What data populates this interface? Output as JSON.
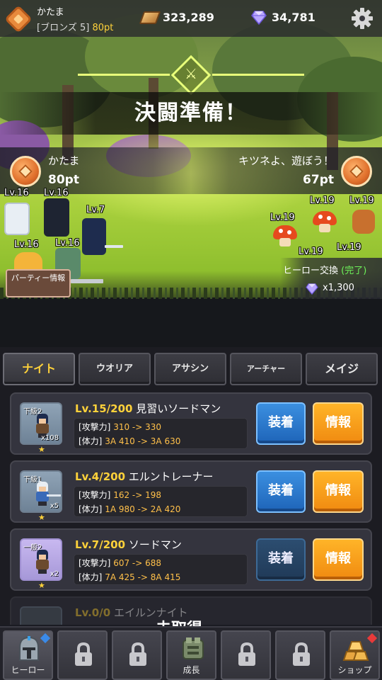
{
  "player": {
    "name": "かたま",
    "rank": "[ブロンズ 5]",
    "points": "80pt"
  },
  "currency": {
    "gold": "323,289",
    "gems": "34,781"
  },
  "duel": {
    "title": "決闘準備！",
    "left": {
      "name": "かたま",
      "points": "80pt"
    },
    "right": {
      "name": "キツネよ、遊ぼう！",
      "points": "67pt"
    }
  },
  "ally_levels": [
    "Lv.16",
    "Lv.16",
    "Lv.7",
    "Lv.16",
    "Lv.16"
  ],
  "enemy_levels": [
    "Lv.19",
    "Lv.19",
    "Lv.19",
    "Lv.19",
    "Lv.19",
    "Lv.19"
  ],
  "party_button": "パーティー情報",
  "exchange": {
    "label": "ヒーロー交換",
    "status": "(完了)",
    "amount": "x1,300"
  },
  "tabs": [
    "ナイト",
    "ウオリア",
    "アサシン",
    "アーチャー",
    "メイジ"
  ],
  "heroes": [
    {
      "grade": "下級2",
      "count": "x108",
      "level": "Lv.15/200",
      "name": "見習いソードマン",
      "atk_label": "[攻撃力]",
      "atk": "310 -> 330",
      "hp_label": "[体力]",
      "hp": "3A 410 -> 3A 630",
      "equip": "装着",
      "info": "情報"
    },
    {
      "grade": "下級1",
      "count": "x5",
      "level": "Lv.4/200",
      "name": "エルントレーナー",
      "atk_label": "[攻撃力]",
      "atk": "162 -> 198",
      "hp_label": "[体力]",
      "hp": "1A 980 -> 2A 420",
      "equip": "装着",
      "info": "情報"
    },
    {
      "grade": "一般2",
      "count": "x2",
      "level": "Lv.7/200",
      "name": "ソードマン",
      "atk_label": "[攻撃力]",
      "atk": "607 -> 688",
      "hp_label": "[体力]",
      "hp": "7A 425 -> 8A 415",
      "equip": "装着",
      "info": "情報"
    },
    {
      "level": "Lv.0/0",
      "name": "エイルンナイト",
      "status": "未取得"
    }
  ],
  "nav": {
    "hero": "ヒーロー",
    "growth": "成長",
    "shop": "ショップ"
  },
  "colors": {
    "accent_yellow": "#ffd23a",
    "equip_blue": "#2a7ad0",
    "info_orange": "#f49a14",
    "done_green": "#6df25a"
  }
}
